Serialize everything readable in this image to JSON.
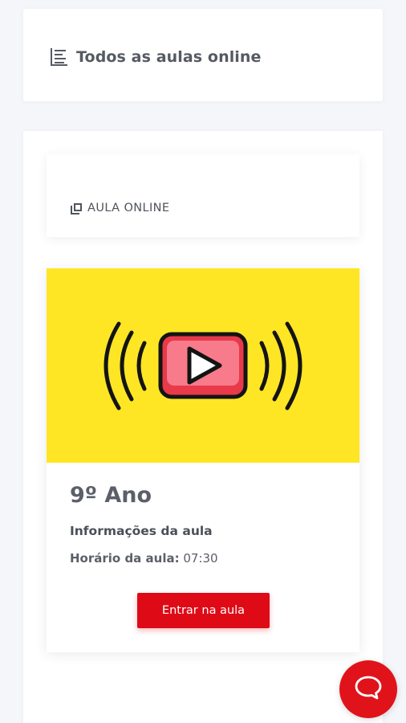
{
  "header": {
    "title": "Todos as aulas online",
    "icon": "list-icon"
  },
  "section": {
    "title": "AULA ONLINE",
    "icon": "book-icon"
  },
  "lesson": {
    "banner_color": "#ffe624",
    "banner_icon": "live-video-icon",
    "grade": "9º Ano",
    "info_label": "Informações da aula",
    "time_label": "Horário da aula:",
    "time_value": "07:30",
    "enter_label": "Entrar na aula",
    "accent": "#de0b17"
  },
  "chat": {
    "icon": "chat-bubble-icon",
    "color": "#e0131b"
  }
}
